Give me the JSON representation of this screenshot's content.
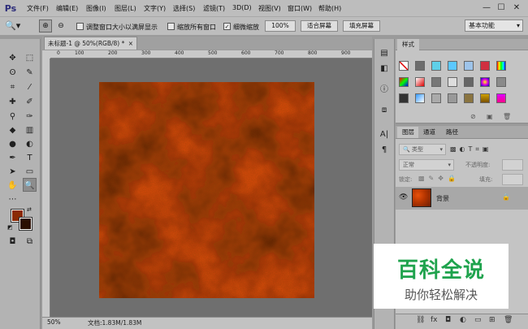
{
  "app": {
    "logo": "Ps"
  },
  "menu": [
    "文件(F)",
    "编辑(E)",
    "图像(I)",
    "图层(L)",
    "文字(Y)",
    "选择(S)",
    "滤镜(T)",
    "3D(D)",
    "视图(V)",
    "窗口(W)",
    "帮助(H)"
  ],
  "window_controls": {
    "minimize": "—",
    "maximize": "☐",
    "close": "✕"
  },
  "options": {
    "resize_windows_label": "调整窗口大小以满屏显示",
    "zoom_all_label": "缩放所有窗口",
    "scrubby_zoom_label": "细微缩放",
    "zoom_100": "100%",
    "fit_screen": "适合屏幕",
    "fill_screen": "填充屏幕",
    "workspace": "基本功能"
  },
  "document": {
    "tab_title": "未标题-1 @ 50%(RGB/8) *",
    "ruler_numbers": [
      "0",
      "100",
      "200",
      "300",
      "400",
      "500",
      "600",
      "700",
      "800",
      "900"
    ],
    "zoom": "50%",
    "doc_info": "文档:1.83M/1.83M"
  },
  "styles_panel": {
    "tab": "样式"
  },
  "layers_panel": {
    "tabs": [
      "图层",
      "通道",
      "路径"
    ],
    "filter_kind": "类型",
    "blend_mode": "正常",
    "opacity_label": "不透明度:",
    "lock_label": "锁定:",
    "fill_label": "填充:",
    "layer_name": "背景"
  },
  "watermark": {
    "title": "百科全说",
    "subtitle": "助你轻松解决"
  },
  "colors": {
    "foreground": "#8b2a05",
    "background": "#2a0e02",
    "accent": "#1fa34d"
  }
}
